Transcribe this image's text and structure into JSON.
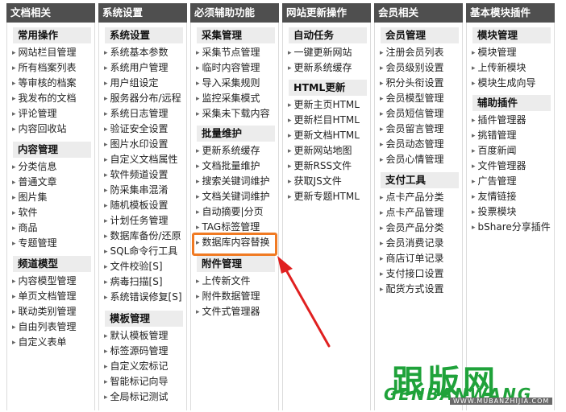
{
  "columns": [
    {
      "title": "文档相关",
      "sections": [
        {
          "title": "常用操作",
          "items": [
            "网站栏目管理",
            "所有档案列表",
            "等审核的档案",
            "我发布的文档",
            "评论管理",
            "内容回收站"
          ]
        },
        {
          "title": "内容管理",
          "items": [
            "分类信息",
            "普通文章",
            "图片集",
            "软件",
            "商品",
            "专题管理"
          ]
        },
        {
          "title": "频道模型",
          "items": [
            "内容模型管理",
            "单页文档管理",
            "联动类别管理",
            "自由列表管理",
            "自定义表单"
          ]
        }
      ]
    },
    {
      "title": "系统设置",
      "sections": [
        {
          "title": "系统设置",
          "items": [
            "系统基本参数",
            "系统用户管理",
            "用户组设定",
            "服务器分布/远程",
            "系统日志管理",
            "验证安全设置",
            "图片水印设置",
            "自定义文档属性",
            "软件频道设置",
            "防采集串混淆",
            "随机模板设置",
            "计划任务管理",
            "数据库备份/还原",
            "SQL命令行工具",
            "文件校验[S]",
            "病毒扫描[S]",
            "系统错误修复[S]"
          ]
        },
        {
          "title": "模板管理",
          "items": [
            "默认模板管理",
            "标签源码管理",
            "自定义宏标记",
            "智能标记向导",
            "全局标记测试"
          ]
        }
      ]
    },
    {
      "title": "必须辅助功能",
      "sections": [
        {
          "title": "采集管理",
          "items": [
            "采集节点管理",
            "临时内容管理",
            "导入采集规则",
            "监控采集模式",
            "采集未下载内容"
          ]
        },
        {
          "title": "批量维护",
          "items": [
            "更新系统缓存",
            "文档批量维护",
            "搜索关键词维护",
            "文档关键词维护",
            "自动摘要|分页",
            "TAG标签管理",
            "数据库内容替换"
          ]
        },
        {
          "title": "附件管理",
          "items": [
            "上传新文件",
            "附件数据管理",
            "文件式管理器"
          ]
        }
      ]
    },
    {
      "title": "网站更新操作",
      "sections": [
        {
          "title": "自动任务",
          "items": [
            "一键更新网站",
            "更新系统缓存"
          ]
        },
        {
          "title": "HTML更新",
          "items": [
            "更新主页HTML",
            "更新栏目HTML",
            "更新文档HTML",
            "更新网站地图",
            "更新RSS文件",
            "获取JS文件",
            "更新专题HTML"
          ]
        }
      ]
    },
    {
      "title": "会员相关",
      "sections": [
        {
          "title": "会员管理",
          "items": [
            "注册会员列表",
            "会员级别设置",
            "积分头衔设置",
            "会员模型管理",
            "会员短信管理",
            "会员留言管理",
            "会员动态管理",
            "会员心情管理"
          ]
        },
        {
          "title": "支付工具",
          "items": [
            "点卡产品分类",
            "点卡产品管理",
            "会员产品分类",
            "会员消费记录",
            "商店订单记录",
            "支付接口设置",
            "配货方式设置"
          ]
        }
      ]
    },
    {
      "title": "基本模块插件",
      "sections": [
        {
          "title": "模块管理",
          "items": [
            "模块管理",
            "上传新模块",
            "模块生成向导"
          ]
        },
        {
          "title": "辅助插件",
          "items": [
            "插件管理器",
            "挑错管理",
            "百度新闻",
            "文件管理器",
            "广告管理",
            "友情链接",
            "投票模块",
            "bShare分享插件"
          ]
        }
      ]
    }
  ],
  "watermark": {
    "cn": "跟版网",
    "en": "GENBANWANG",
    "url": "WWW.MUBANZHIJIA.COM",
    "color": "#1fa23a"
  },
  "colors": {
    "header_bg": "#4f4f4f",
    "section_bg": "#ececec",
    "highlight": "#f07a23",
    "arrow": "#e02020"
  }
}
